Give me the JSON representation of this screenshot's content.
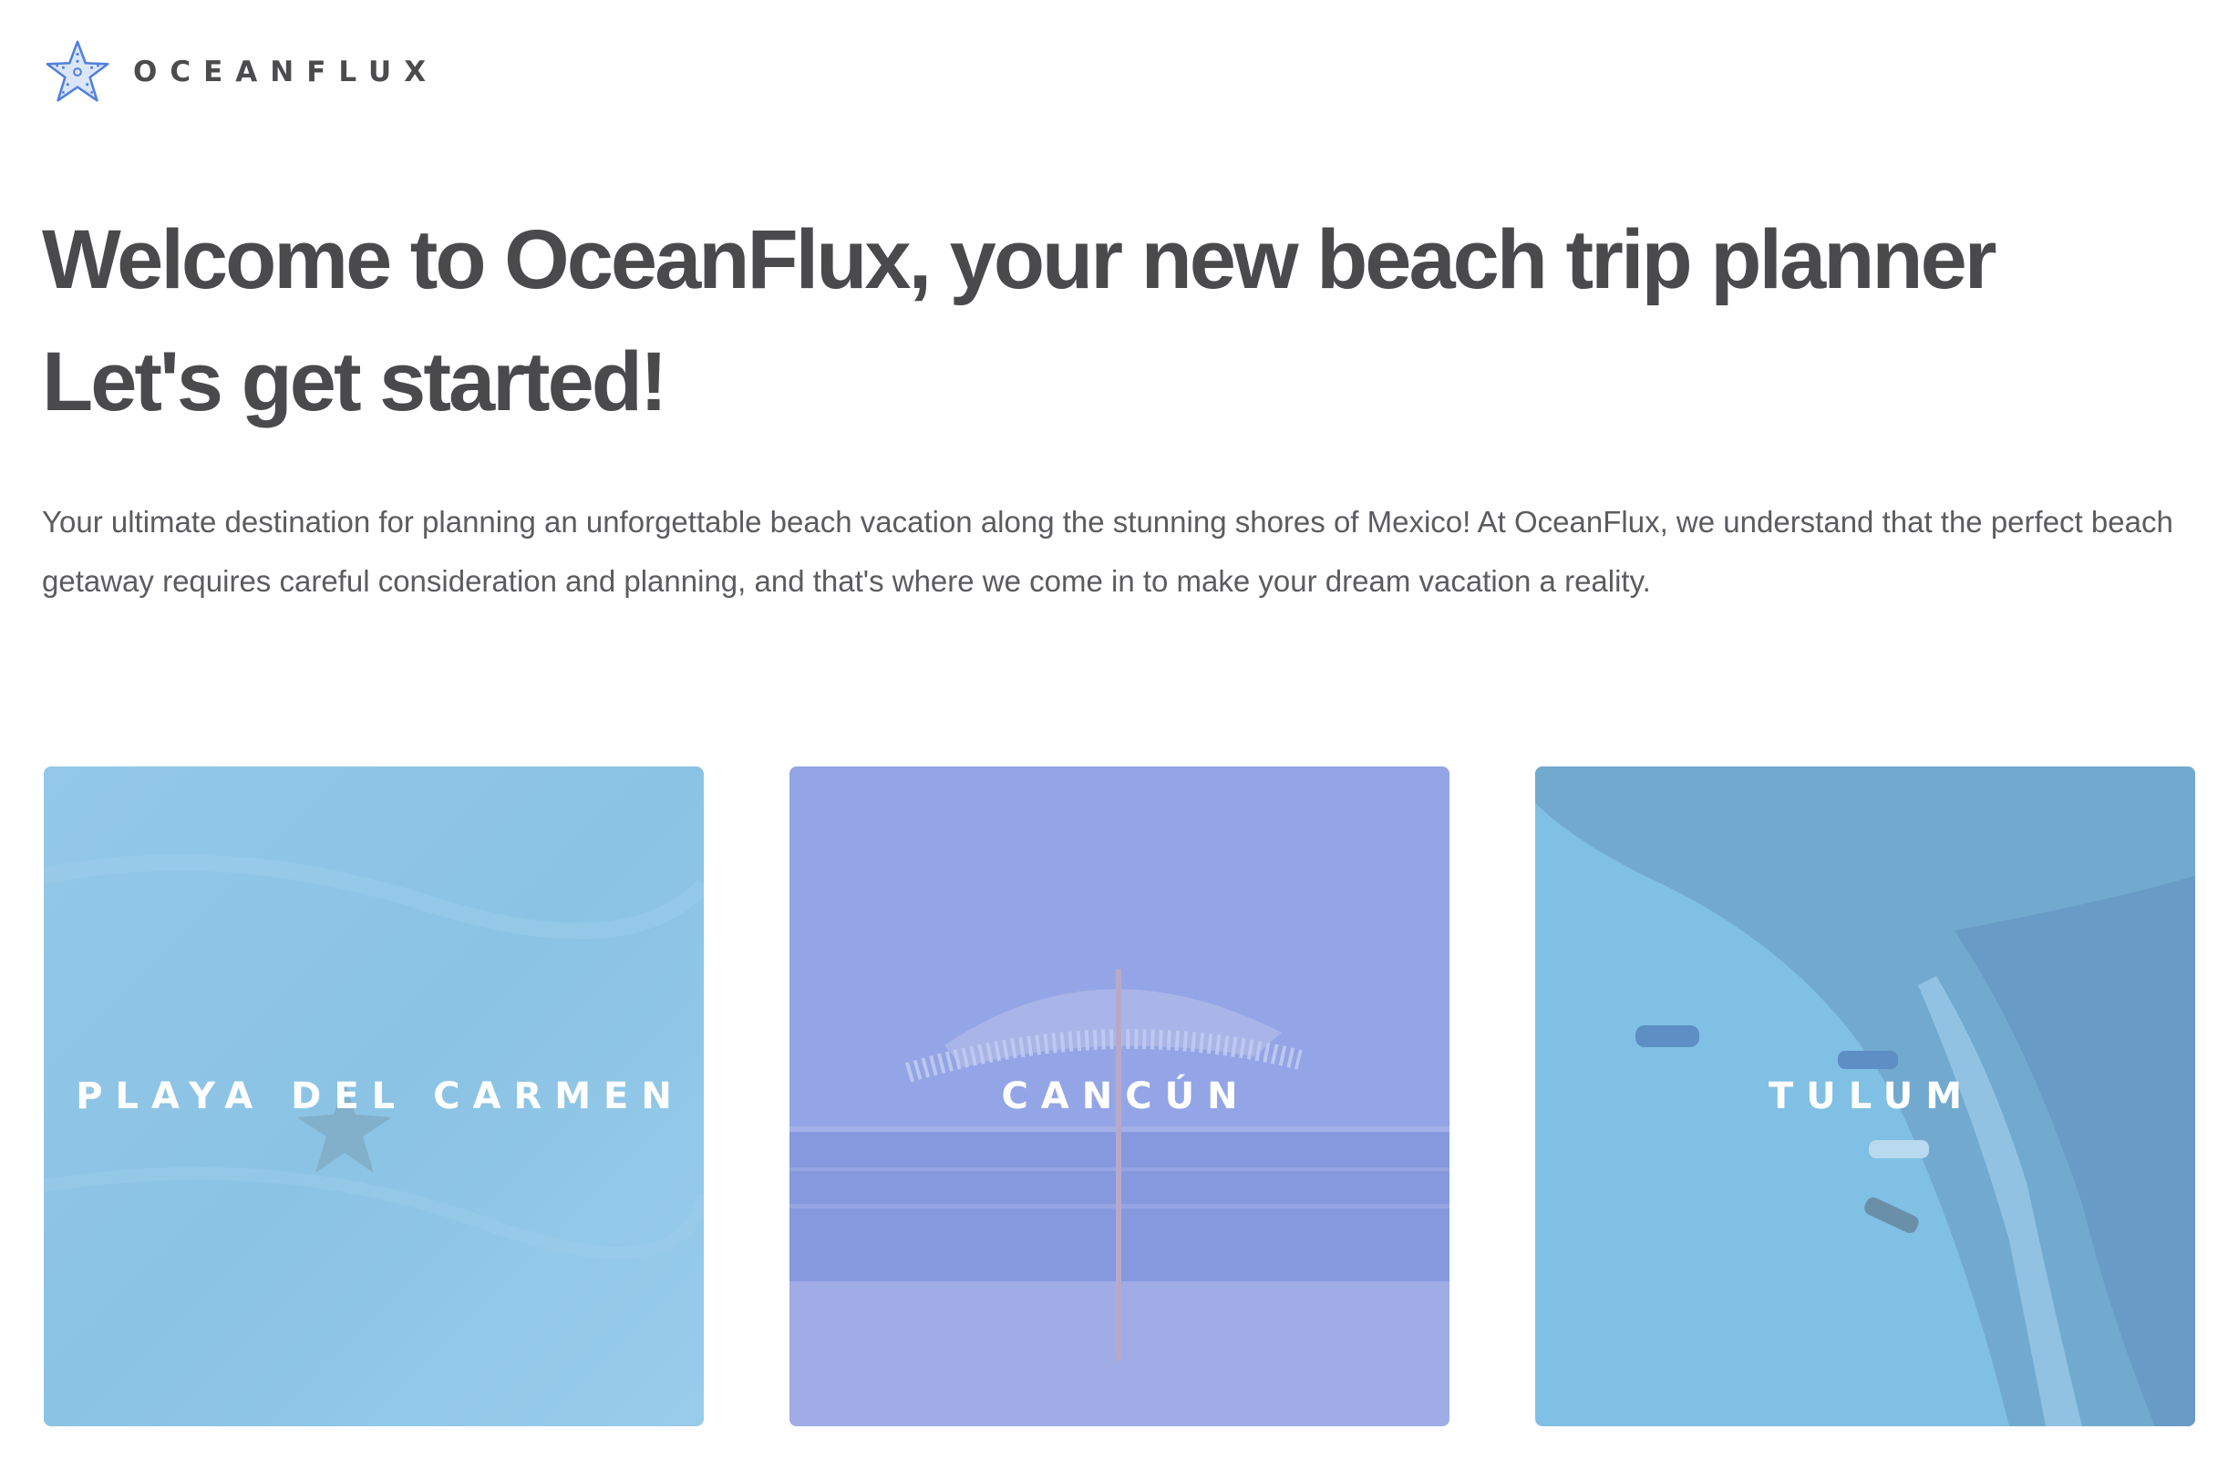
{
  "brand": {
    "name": "OCEANFLUX",
    "icon": "starfish-icon",
    "accent_color": "#4f7fe0"
  },
  "hero": {
    "title_line1": "Welcome to OceanFlux, your new beach trip planner",
    "title_line2": "Let's get started!",
    "description": "Your ultimate destination for planning an unforgettable beach vacation along the stunning shores of Mexico! At OceanFlux, we understand that the perfect beach getaway requires careful consideration and planning, and that's where we come in to make your dream vacation a reality."
  },
  "destinations": [
    {
      "label": "PLAYA DEL CARMEN",
      "overlay_color": "#8ec6e6"
    },
    {
      "label": "CANCÚN",
      "overlay_color": "#95a6e6"
    },
    {
      "label": "TULUM",
      "overlay_color": "#7fbfe3"
    }
  ]
}
